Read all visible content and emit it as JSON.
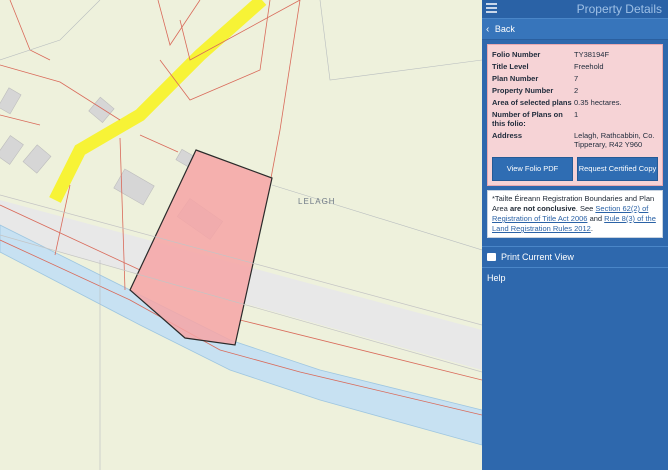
{
  "header": {
    "title": "Property Details",
    "menu_icon": "hamburger-icon"
  },
  "back": {
    "label": "Back",
    "icon": "chevron-left-icon"
  },
  "property": {
    "rows": [
      {
        "key": "Folio Number",
        "value": "TY38194F"
      },
      {
        "key": "Title Level",
        "value": "Freehold"
      },
      {
        "key": "Plan Number",
        "value": "7"
      },
      {
        "key": "Property Number",
        "value": "2"
      },
      {
        "key": "Area of selected plans",
        "value": "0.35 hectares."
      },
      {
        "key": "Number of Plans on this folio:",
        "value": "1"
      },
      {
        "key": "Address",
        "value": "Lelagh, Rathcabbin, Co. Tipperary, R42 Y960"
      }
    ],
    "view_pdf_label": "View Folio PDF",
    "certified_copy_label": "Request Certified Copy"
  },
  "note": {
    "part1": "*Tailte Éireann Registration Boundaries and Plan Area ",
    "bold": "are not conclusive",
    "part2": ". See ",
    "link1": "Section 62(2) of Registration of Title Act 2006",
    "part3": " and ",
    "link2": "Rule 8(3) of the Land Registration Rules 2012",
    "part4": "."
  },
  "menu": {
    "print_label": "Print Current View",
    "print_icon": "print-icon",
    "help_label": "Help"
  },
  "map": {
    "townland_label": "LELAGH",
    "colors": {
      "background": "#eef1dc",
      "road": "#f7f336",
      "river": "#c7e1f2",
      "plot": "#f6a4a6",
      "boundary": "#d96a5a"
    }
  }
}
